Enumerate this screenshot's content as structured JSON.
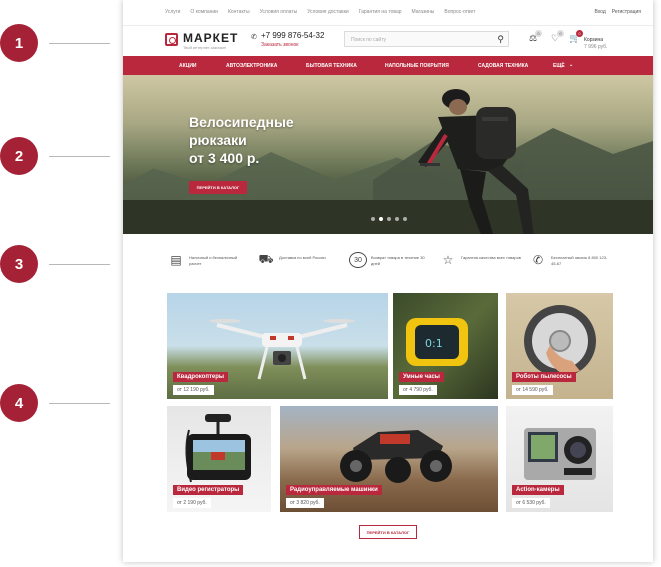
{
  "callouts": [
    "1",
    "2",
    "3",
    "4"
  ],
  "topbar": {
    "links": [
      "Услуги",
      "О компании",
      "Контакты",
      "Условия оплаты",
      "Условия доставки",
      "Гарантия на товар",
      "Магазины",
      "Вопрос-ответ"
    ],
    "login": "Вход",
    "register": "Регистрация"
  },
  "header": {
    "logo": "МАРКЕТ",
    "logo_sub": "Твой интернет-магазин",
    "phone": "+7 999 876-54-32",
    "callback": "Заказать звонок",
    "search_placeholder": "Поиск по сайту",
    "compare_count": "0",
    "favorites_count": "0",
    "cart_count": "0",
    "cart_label": "Корзина",
    "cart_sum": "7 996 руб."
  },
  "nav": [
    "АКЦИИ",
    "АВТОЭЛЕКТРОНИКА",
    "БЫТОВАЯ ТЕХНИКА",
    "НАПОЛЬНЫЕ ПОКРЫТИЯ",
    "САДОВАЯ ТЕХНИКА",
    "ЕЩЁ"
  ],
  "hero": {
    "title_lines": [
      "Велосипедные",
      "рюкзаки",
      "от 3 400 р."
    ],
    "button": "ПЕРЕЙТИ В КАТАЛОГ",
    "slides": 5,
    "active_slide": 1
  },
  "features": [
    {
      "icon": "wallet-icon",
      "text": "Наличный и безналичный расчет"
    },
    {
      "icon": "truck-icon",
      "text": "Доставка по всей России"
    },
    {
      "icon": "return-30-icon",
      "text": "Возврат товара в течение 30 дней"
    },
    {
      "icon": "shield-star-icon",
      "text": "Гарантия качества всех товаров"
    },
    {
      "icon": "phone-icon",
      "text": "Бесплатный звонок 8 800 123-45-67"
    }
  ],
  "tiles": [
    {
      "label": "Квадрокоптеры",
      "price": "от 12 190 руб."
    },
    {
      "label": "Умные часы",
      "price": "от 4 790 руб."
    },
    {
      "label": "Роботы пылесосы",
      "price": "от 14 590 руб."
    },
    {
      "label": "Видео регистраторы",
      "price": "от 2 190 руб."
    },
    {
      "label": "Радиоуправляемые машинки",
      "price": "от 3 820 руб."
    },
    {
      "label": "Action-камеры",
      "price": "от 6 530 руб."
    }
  ],
  "catalog_button": "ПЕРЕЙТИ В КАТАЛОГ",
  "colors": {
    "accent": "#b9283c",
    "callout": "#a52236"
  }
}
